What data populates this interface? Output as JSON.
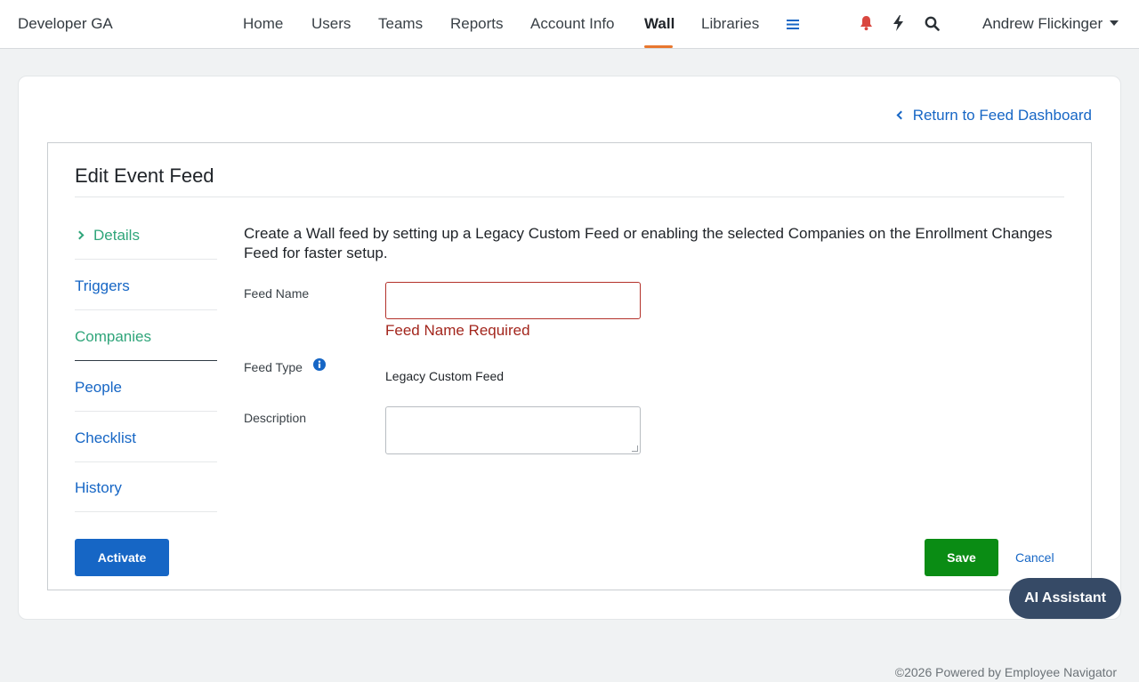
{
  "nav": {
    "brand": "Developer GA",
    "links": [
      "Home",
      "Users",
      "Teams",
      "Reports",
      "Account Info",
      "Wall",
      "Libraries"
    ],
    "active": "Wall",
    "icons": [
      "menu-icon",
      "bell-icon",
      "bolt-icon",
      "search-icon"
    ],
    "user": "Andrew Flickinger"
  },
  "page": {
    "return_link": "Return to Feed Dashboard",
    "title": "Edit Event Feed",
    "intro": "Create a Wall feed by setting up a Legacy Custom Feed or enabling the selected Companies on the Enrollment Changes Feed for faster setup."
  },
  "side_menu": {
    "items": [
      "Details",
      "Triggers",
      "Companies",
      "People",
      "Checklist",
      "History"
    ],
    "current": "Details",
    "selected": "Companies"
  },
  "form": {
    "feed_name_label": "Feed Name",
    "feed_name_value": "",
    "feed_name_error": "Feed Name Required",
    "feed_type_label": "Feed Type",
    "feed_type_value": "Legacy Custom Feed",
    "description_label": "Description",
    "description_value": ""
  },
  "actions": {
    "activate": "Activate",
    "save": "Save",
    "cancel": "Cancel"
  },
  "ai_assistant": "AI Assistant",
  "footer": "©2026 Powered by Employee Navigator",
  "colors": {
    "link": "#1666c5",
    "active_underline": "#e8772e",
    "current_tab": "#2fa57a",
    "error": "#a3261d",
    "save": "#0a8c14",
    "assistant": "#364a66",
    "bell": "#d9473f"
  }
}
